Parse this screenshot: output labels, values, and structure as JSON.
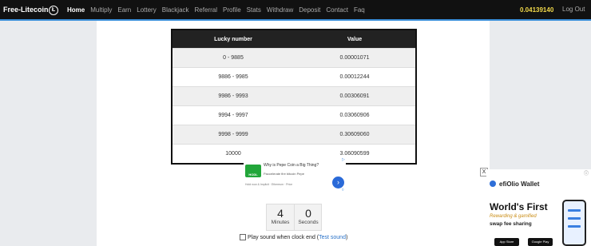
{
  "nav": {
    "brand": "Free-Litecoin",
    "brand_icon": "Ł",
    "items": [
      "Home",
      "Multiply",
      "Earn",
      "Lottery",
      "Blackjack",
      "Referral",
      "Profile",
      "Stats",
      "Withdraw",
      "Deposit",
      "Contact",
      "Faq"
    ],
    "balance": "0.04139140",
    "logout": "Log Out"
  },
  "table": {
    "headers": [
      "Lucky number",
      "Value"
    ],
    "rows": [
      [
        "0 - 9885",
        "0.00001071"
      ],
      [
        "9886 - 9985",
        "0.00012244"
      ],
      [
        "9986 - 9993",
        "0.00306091"
      ],
      [
        "9994 - 9997",
        "0.03060906"
      ],
      [
        "9998 - 9999",
        "0.30609060"
      ],
      [
        "10000",
        "3.06090599"
      ]
    ]
  },
  "ad": {
    "logo_text": "HODL",
    "title": "Why is Pepe Coin a Big Thing?",
    "subtitle": "Paccelerate fire bitcoin Pepe",
    "meta": "Hold now & Implicit · Ethereum · Price",
    "arrow": "›",
    "choice": "▷",
    "choice2": "◊"
  },
  "timer": {
    "minutes": "4",
    "minutes_label": "Minutes",
    "seconds": "0",
    "seconds_label": "Seconds"
  },
  "sound": {
    "label": "Play sound when clock end (",
    "link": "Test sound",
    "close": ")"
  },
  "right_ad": {
    "close": "X",
    "info": "ⓘ",
    "brand": "efiOlio Wallet",
    "title": "World's First",
    "subtitle": "Rewarding & gamified",
    "tagline": "swap fee sharing",
    "store1": "App Store",
    "store2": "Google Play"
  },
  "colors": {
    "nav_bg": "#111111",
    "nav_accent": "#3a8ed8",
    "balance": "#f1d94a",
    "table_header": "#222222"
  }
}
